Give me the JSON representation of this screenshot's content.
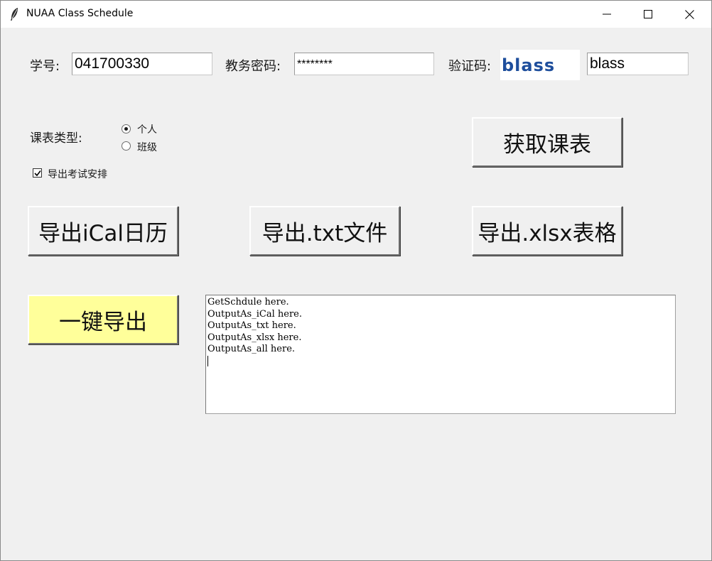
{
  "window": {
    "title": "NUAA Class Schedule"
  },
  "login": {
    "student_id_label": "学号:",
    "student_id_value": "041700330",
    "password_label": "教务密码:",
    "password_value": "********",
    "captcha_label": "验证码:",
    "captcha_image_text": "blass",
    "captcha_value": "blass"
  },
  "options": {
    "schedule_type_label": "课表类型:",
    "radio_personal": "个人",
    "radio_class": "班级",
    "selected": "个人",
    "export_exam_label": "导出考试安排",
    "export_exam_checked": true
  },
  "buttons": {
    "get_schedule": "获取课表",
    "export_ical": "导出iCal日历",
    "export_txt": "导出.txt文件",
    "export_xlsx": "导出.xlsx表格",
    "export_all": "一键导出"
  },
  "console": {
    "lines": [
      "GetSchdule here.",
      "OutputAs_iCal here.",
      "OutputAs_txt here.",
      "OutputAs_xlsx here.",
      "OutputAs_all here."
    ]
  },
  "colors": {
    "window_bg": "#f0f0f0",
    "export_all_bg": "#ffff9a",
    "captcha_text": "#1e4e9c"
  }
}
